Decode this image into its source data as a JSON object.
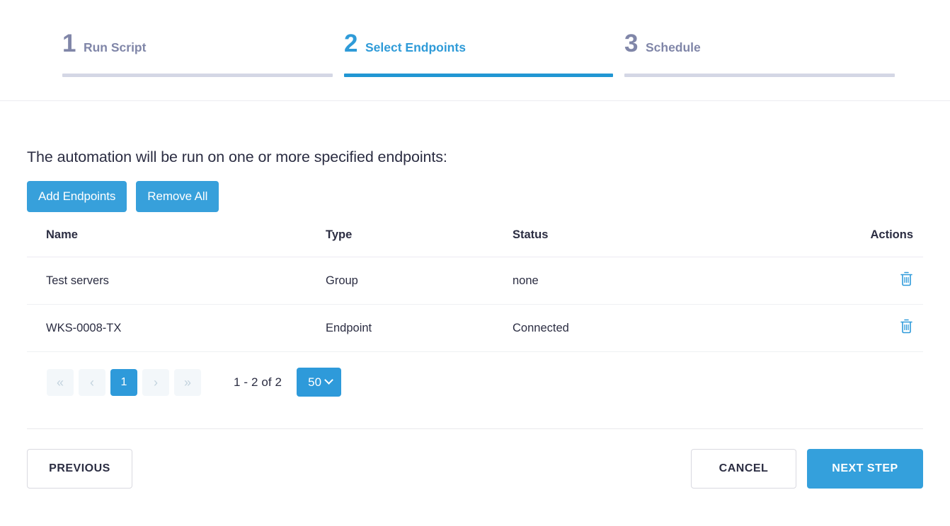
{
  "stepper": {
    "steps": [
      {
        "number": "1",
        "label": "Run Script",
        "state": "inactive"
      },
      {
        "number": "2",
        "label": "Select Endpoints",
        "state": "active"
      },
      {
        "number": "3",
        "label": "Schedule",
        "state": "inactive"
      }
    ]
  },
  "main": {
    "intro": "The automation will be run on one or more specified endpoints:",
    "actions": {
      "add_endpoints_label": "Add Endpoints",
      "remove_all_label": "Remove All"
    },
    "table": {
      "columns": [
        "Name",
        "Type",
        "Status",
        "Actions"
      ],
      "rows": [
        {
          "name": "Test servers",
          "type": "Group",
          "status": "none",
          "action_icon": "trash-icon"
        },
        {
          "name": "WKS-0008-TX",
          "type": "Endpoint",
          "status": "Connected",
          "action_icon": "trash-icon"
        }
      ]
    },
    "pagination": {
      "first_label": "«",
      "prev_label": "‹",
      "current_page": "1",
      "next_label": "›",
      "last_label": "»",
      "range_text": "1 - 2 of 2",
      "page_size": "50"
    }
  },
  "footer": {
    "previous_label": "PREVIOUS",
    "cancel_label": "CANCEL",
    "next_step_label": "NEXT STEP"
  },
  "colors": {
    "accent_blue": "#2e9ada",
    "step_active": "#2f9bd8",
    "step_inactive": "#8086a8",
    "step_bar_inactive": "#d4d7e5",
    "text": "#2b2d42",
    "trash_icon": "#2e9ada"
  }
}
